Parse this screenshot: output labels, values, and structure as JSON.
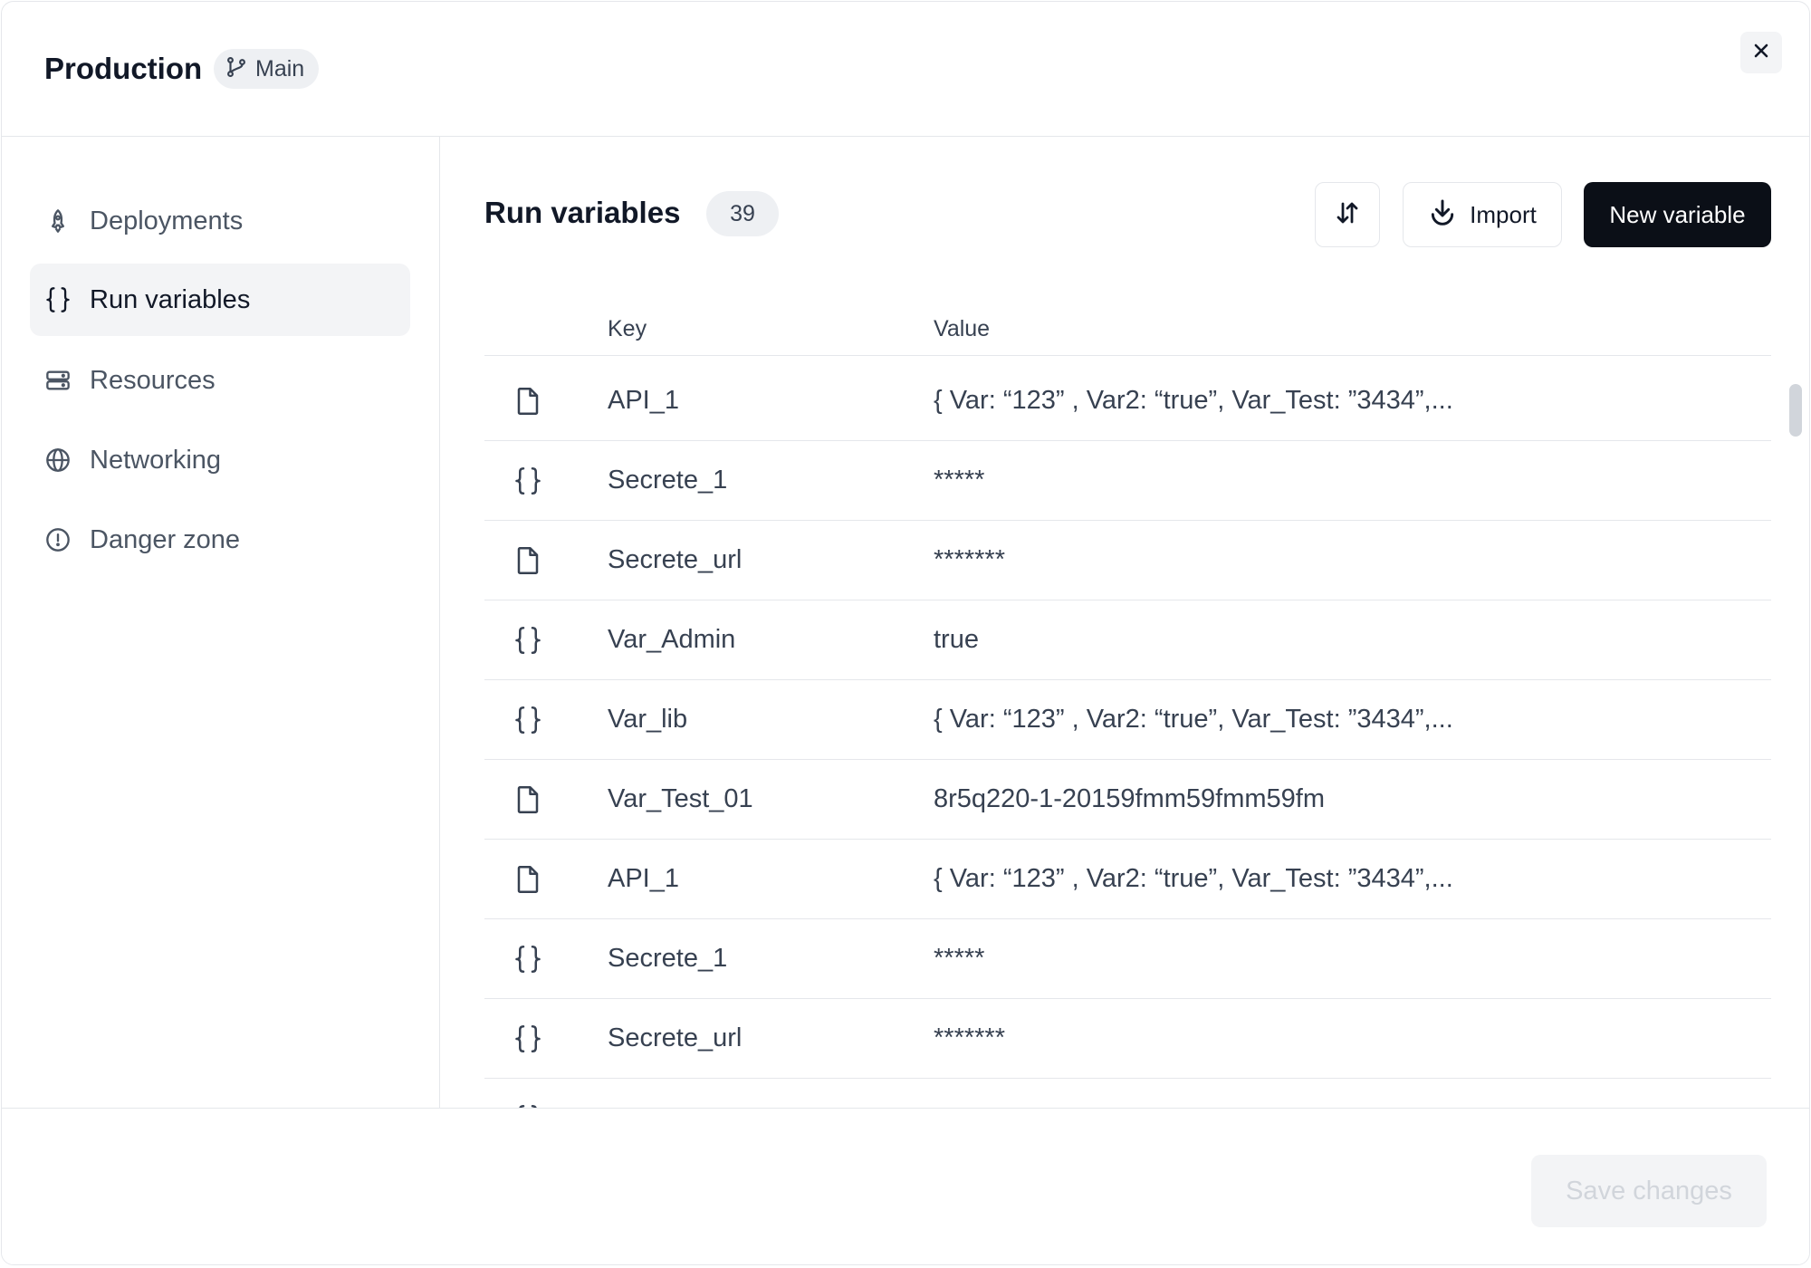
{
  "header": {
    "title": "Production",
    "branch_label": "Main"
  },
  "sidebar": {
    "items": [
      {
        "label": "Deployments",
        "icon": "rocket-icon",
        "active": false
      },
      {
        "label": "Run variables",
        "icon": "braces-icon",
        "active": true
      },
      {
        "label": "Resources",
        "icon": "server-icon",
        "active": false
      },
      {
        "label": "Networking",
        "icon": "globe-icon",
        "active": false
      },
      {
        "label": "Danger zone",
        "icon": "alert-circle-icon",
        "active": false
      }
    ]
  },
  "main": {
    "title": "Run variables",
    "count": "39",
    "import_label": "Import",
    "new_label": "New variable",
    "columns": {
      "key": "Key",
      "value": "Value"
    },
    "rows": [
      {
        "type": "file",
        "key": "API_1",
        "value": "{ Var: “123” , Var2: “true”, Var_Test: ”3434”,..."
      },
      {
        "type": "json",
        "key": "Secrete_1",
        "value": "*****"
      },
      {
        "type": "file",
        "key": "Secrete_url",
        "value": "*******"
      },
      {
        "type": "json",
        "key": "Var_Admin",
        "value": "true"
      },
      {
        "type": "json",
        "key": "Var_lib",
        "value": "{ Var: “123” , Var2: “true”, Var_Test: ”3434”,..."
      },
      {
        "type": "file",
        "key": "Var_Test_01",
        "value": "8r5q220-1-20159fmm59fmm59fm"
      },
      {
        "type": "file",
        "key": "API_1",
        "value": "{ Var: “123” , Var2: “true”, Var_Test: ”3434”,..."
      },
      {
        "type": "json",
        "key": "Secrete_1",
        "value": "*****"
      },
      {
        "type": "json",
        "key": "Secrete_url",
        "value": "*******"
      }
    ]
  },
  "footer": {
    "save_label": "Save changes"
  }
}
